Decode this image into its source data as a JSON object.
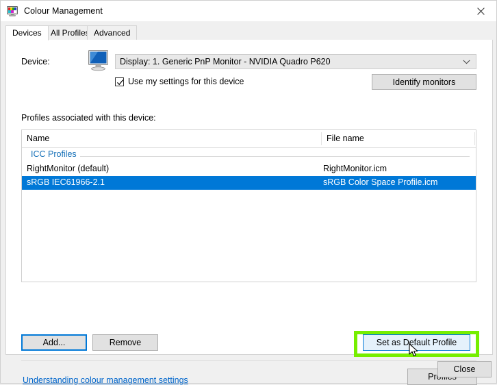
{
  "window": {
    "title": "Colour Management",
    "icon": "colour-monitor-icon",
    "close_glyph": "✕"
  },
  "tabs": [
    {
      "label": "Devices",
      "selected": true
    },
    {
      "label": "All Profiles",
      "selected": false
    },
    {
      "label": "Advanced",
      "selected": false
    }
  ],
  "device_section": {
    "label": "Device:",
    "icon": "monitor-icon",
    "selected_device": "Display: 1. Generic PnP Monitor - NVIDIA Quadro P620",
    "dropdown_arrow": "chevron-down-icon",
    "use_settings_checkbox": {
      "label": "Use my settings for this device",
      "checked": true
    },
    "identify_monitors_label": "Identify monitors"
  },
  "profiles_section": {
    "heading": "Profiles associated with this device:",
    "columns": [
      "Name",
      "File name"
    ],
    "group_label": "ICC Profiles",
    "rows": [
      {
        "name": "RightMonitor (default)",
        "file": "RightMonitor.icm",
        "selected": false
      },
      {
        "name": "sRGB IEC61966-2.1",
        "file": "sRGB Color Space Profile.icm",
        "selected": true
      }
    ]
  },
  "buttons": {
    "add": "Add...",
    "remove": "Remove",
    "set_as_default": "Set as Default Profile",
    "profiles": "Profiles",
    "close": "Close"
  },
  "help_link": "Understanding colour management settings",
  "colors": {
    "highlight_annotation": "#76ee00",
    "selection_blue": "#0078d7",
    "link_blue": "#0066cc",
    "group_label_blue": "#1570b8",
    "button_face": "#e1e1e1",
    "hover_button_face": "#e5f1fb"
  }
}
